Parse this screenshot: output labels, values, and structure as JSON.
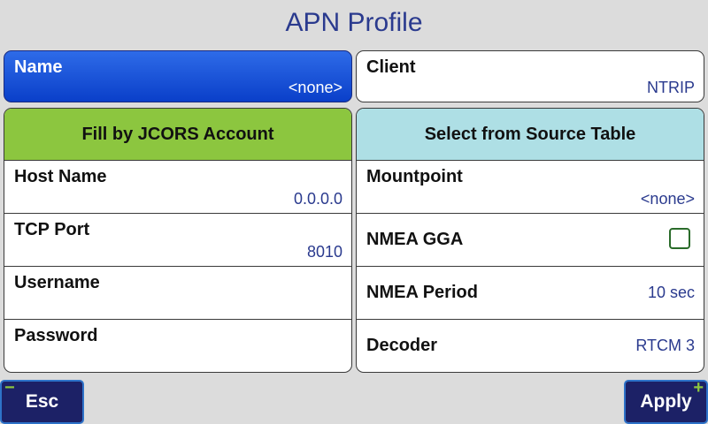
{
  "title": "APN Profile",
  "name": {
    "label": "Name",
    "value": "<none>"
  },
  "client": {
    "label": "Client",
    "value": "NTRIP"
  },
  "left_panel": {
    "header": "Fill by JCORS Account",
    "rows": [
      {
        "label": "Host Name",
        "value": "0.0.0.0"
      },
      {
        "label": "TCP Port",
        "value": "8010"
      },
      {
        "label": "Username",
        "value": ""
      },
      {
        "label": "Password",
        "value": ""
      }
    ]
  },
  "right_panel": {
    "header": "Select from Source Table",
    "rows": [
      {
        "label": "Mountpoint",
        "value": "<none>"
      },
      {
        "label": "NMEA GGA",
        "checked": false
      },
      {
        "label": "NMEA Period",
        "value": "10 sec"
      },
      {
        "label": "Decoder",
        "value": "RTCM 3"
      }
    ]
  },
  "buttons": {
    "esc": {
      "label": "Esc",
      "corner_icon": "minus-icon",
      "corner_glyph": "−"
    },
    "apply": {
      "label": "Apply",
      "corner_icon": "plus-icon",
      "corner_glyph": "+"
    }
  },
  "colors": {
    "title": "#2a3a8e",
    "selected": "#0a3fc9",
    "left_header": "#8cc63f",
    "right_header": "#aedfe5",
    "button_bg": "#1c2166",
    "value_text": "#2a3a8e"
  }
}
